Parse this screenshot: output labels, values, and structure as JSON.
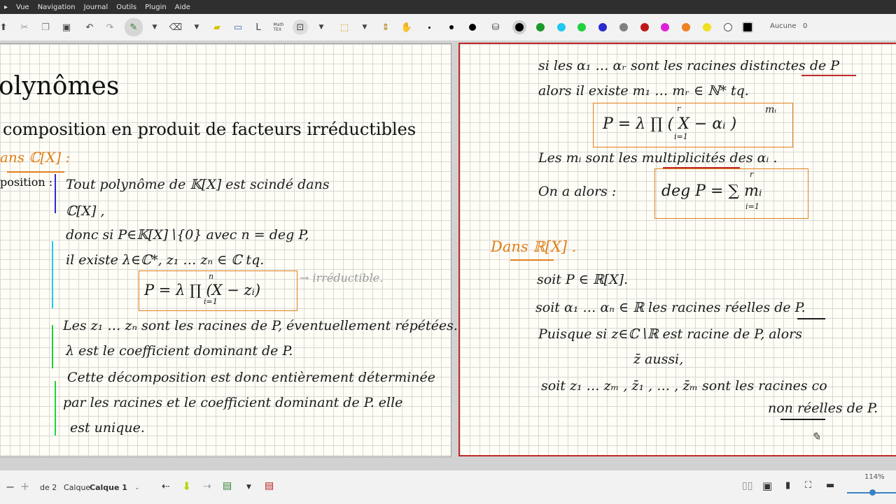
{
  "menu": [
    "Vue",
    "Navigation",
    "Journal",
    "Outils",
    "Plugin",
    "Aide"
  ],
  "toolbar": {
    "math_tex_label": "Math\nTEX",
    "line_style_label": "Aucune",
    "line_style_value": "0",
    "colors": [
      "#000000",
      "#1a9a2a",
      "#1ec8f0",
      "#22d13d",
      "#2b2bd1",
      "#808080",
      "#e020d6",
      "#f08020",
      "#f0e020",
      "#ffffff",
      "#000000"
    ]
  },
  "page1": {
    "title": "olynômes",
    "subtitle": "composition en produit de facteurs irréductibles",
    "heading_orange": "ans  ℂ[X] :",
    "label_position": "position :",
    "lines": [
      "Tout polynôme de 𝕂[X] est scindé dans",
      "ℂ[X] ,",
      "donc si P∈𝕂[X]∖{0} avec n = deg P,",
      "il existe λ∈ℂ*, z₁ … zₙ ∈ ℂ tq.",
      "Les z₁ … zₙ sont les racines de P, éventuellement répétées.",
      "λ est le coefficient dominant de P.",
      "Cette décomposition est donc entièrement déterminée",
      "par les racines et le coefficient dominant de P. elle",
      "est unique."
    ],
    "formula": "P =  λ ∏ (X − zᵢ)",
    "formula_upper": "n",
    "formula_lower": "i=1",
    "annotation": "→ irréductible."
  },
  "page2": {
    "lines": [
      "si les α₁ … αᵣ sont les racines distinctes de P",
      "alors il existe m₁ … mᵣ ∈ ℕ* tq.",
      "Les mᵢ sont les multiplicités des αᵢ .",
      "On a alors :",
      "soit P ∈ ℝ[X].",
      "soit α₁ … αₙ ∈ ℝ les racines réelles de P.",
      "Puisque si z∈ℂ∖ℝ est racine de P, alors",
      "z̄ aussi,",
      "soit z₁ … zₘ , z̄₁ , … , z̄ₘ sont les racines co",
      "non réelles de P."
    ],
    "formula1": "P  =  λ ∏ ( X − αᵢ )",
    "formula1_upper": "r",
    "formula1_lower": "i=1",
    "formula1_exp": "mᵢ",
    "formula2": "deg P  =  ∑ mᵢ",
    "formula2_upper": "r",
    "formula2_lower": "i=1",
    "heading_orange": "Dans  ℝ[X] ."
  },
  "status": {
    "page_of": "de 2",
    "layer_label": "Calque",
    "layer_value": "Calque 1",
    "zoom": "114%"
  }
}
